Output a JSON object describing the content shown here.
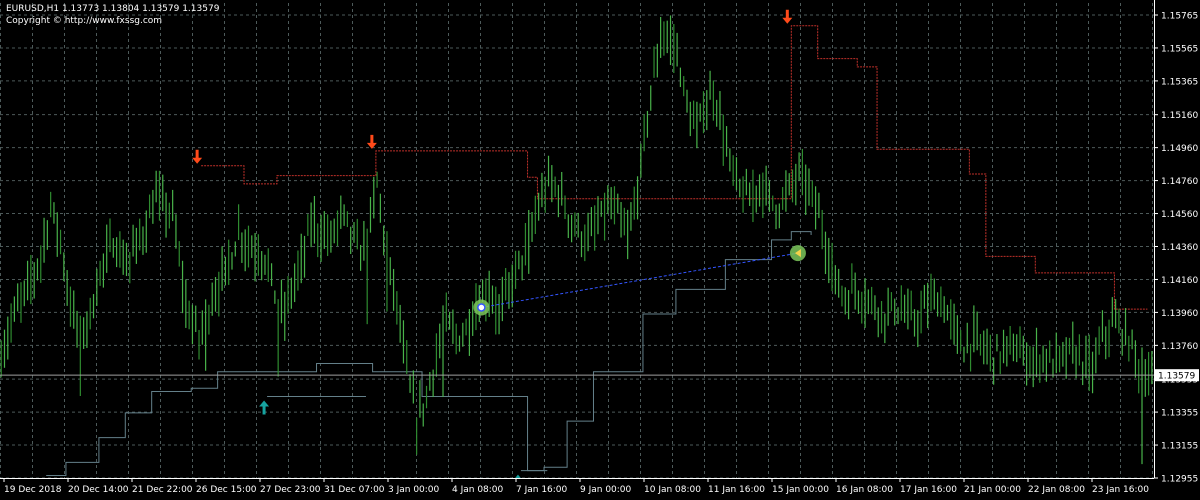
{
  "header": {
    "title": "EURUSD,H1  1.13773 1.13804 1.13579 1.13579",
    "copyright": "Copyright © http://www.fxssg.com"
  },
  "colors": {
    "background": "#000000",
    "grid": "#4d5a5a",
    "candle": "#49b34a",
    "candle_dark": "#2f8c30",
    "stop_line": "#c0302a",
    "trail_line": "#64808a",
    "connector": "#3355ff",
    "arrow_sell": "#ff4a1a",
    "arrow_buy": "#16a3a0",
    "marker": "#7cc85c",
    "axis_text": "#ffffff",
    "current_price_line": "#a0a0a0"
  },
  "chart_data": {
    "type": "line",
    "symbol": "EURUSD",
    "timeframe": "H1",
    "ylim": [
      1.12955,
      1.15765
    ],
    "y_ticks": [
      "1.15765",
      "1.15565",
      "1.15365",
      "1.15160",
      "1.14960",
      "1.14760",
      "1.14560",
      "1.14360",
      "1.14160",
      "1.13960",
      "1.13760",
      "1.13555",
      "1.13355",
      "1.13155",
      "1.12955"
    ],
    "x_ticks": [
      "19 Dec 2018",
      "20 Dec 14:00",
      "21 Dec 22:00",
      "26 Dec 15:00",
      "27 Dec 23:00",
      "31 Dec 07:00",
      "3 Jan 00:00",
      "4 Jan 08:00",
      "7 Jan 16:00",
      "9 Jan 00:00",
      "10 Jan 08:00",
      "11 Jan 16:00",
      "15 Jan 00:00",
      "16 Jan 08:00",
      "17 Jan 16:00",
      "21 Jan 00:00",
      "22 Jan 08:00",
      "23 Jan 16:00"
    ],
    "current_price": "1.13579",
    "price_path": [
      [
        0,
        1.137
      ],
      [
        4,
        1.1395
      ],
      [
        8,
        1.141
      ],
      [
        12,
        1.143
      ],
      [
        15,
        1.146
      ],
      [
        18,
        1.144
      ],
      [
        21,
        1.14
      ],
      [
        24,
        1.138
      ],
      [
        27,
        1.1395
      ],
      [
        30,
        1.142
      ],
      [
        34,
        1.144
      ],
      [
        38,
        1.1425
      ],
      [
        42,
        1.144
      ],
      [
        47,
        1.1465
      ],
      [
        52,
        1.1455
      ],
      [
        56,
        1.14
      ],
      [
        60,
        1.138
      ],
      [
        64,
        1.1405
      ],
      [
        68,
        1.142
      ],
      [
        72,
        1.1445
      ],
      [
        76,
        1.1435
      ],
      [
        80,
        1.143
      ],
      [
        84,
        1.14
      ],
      [
        86,
        1.1395
      ],
      [
        88,
        1.141
      ],
      [
        91,
        1.1425
      ],
      [
        94,
        1.145
      ],
      [
        97,
        1.1445
      ],
      [
        100,
        1.144
      ],
      [
        103,
        1.1455
      ],
      [
        106,
        1.1445
      ],
      [
        109,
        1.143
      ],
      [
        112,
        1.145
      ],
      [
        114,
        1.1475
      ],
      [
        117,
        1.143
      ],
      [
        120,
        1.14
      ],
      [
        123,
        1.136
      ],
      [
        126,
        1.133
      ],
      [
        129,
        1.1345
      ],
      [
        132,
        1.137
      ],
      [
        135,
        1.139
      ],
      [
        138,
        1.138
      ],
      [
        141,
        1.1385
      ],
      [
        144,
        1.14
      ],
      [
        148,
        1.141
      ],
      [
        151,
        1.1395
      ],
      [
        154,
        1.141
      ],
      [
        157,
        1.1425
      ],
      [
        160,
        1.144
      ],
      [
        163,
        1.146
      ],
      [
        166,
        1.1475
      ],
      [
        169,
        1.147
      ],
      [
        172,
        1.1455
      ],
      [
        175,
        1.1445
      ],
      [
        178,
        1.144
      ],
      [
        181,
        1.145
      ],
      [
        184,
        1.146
      ],
      [
        187,
        1.1455
      ],
      [
        190,
        1.144
      ],
      [
        193,
        1.147
      ],
      [
        195,
        1.15
      ],
      [
        197,
        1.153
      ],
      [
        199,
        1.155
      ],
      [
        201,
        1.1565
      ],
      [
        203,
        1.156
      ],
      [
        205,
        1.1555
      ],
      [
        207,
        1.153
      ],
      [
        209,
        1.1515
      ],
      [
        211,
        1.1505
      ],
      [
        213,
        1.152
      ],
      [
        216,
        1.153
      ],
      [
        218,
        1.1515
      ],
      [
        221,
        1.1485
      ],
      [
        224,
        1.147
      ],
      [
        227,
        1.1465
      ],
      [
        230,
        1.1475
      ],
      [
        233,
        1.1465
      ],
      [
        236,
        1.146
      ],
      [
        239,
        1.147
      ],
      [
        242,
        1.148
      ],
      [
        245,
        1.147
      ],
      [
        248,
        1.1455
      ],
      [
        250,
        1.144
      ],
      [
        253,
        1.1415
      ],
      [
        256,
        1.1405
      ],
      [
        259,
        1.141
      ],
      [
        262,
        1.1405
      ],
      [
        265,
        1.14
      ],
      [
        268,
        1.1395
      ],
      [
        271,
        1.14
      ],
      [
        274,
        1.1395
      ],
      [
        277,
        1.139
      ],
      [
        280,
        1.1398
      ],
      [
        283,
        1.1405
      ],
      [
        286,
        1.14
      ],
      [
        289,
        1.1385
      ],
      [
        292,
        1.1375
      ],
      [
        295,
        1.138
      ],
      [
        298,
        1.1375
      ],
      [
        301,
        1.137
      ],
      [
        304,
        1.1372
      ],
      [
        307,
        1.1375
      ],
      [
        310,
        1.137
      ],
      [
        313,
        1.1366
      ],
      [
        316,
        1.137
      ],
      [
        319,
        1.1365
      ],
      [
        322,
        1.1368
      ],
      [
        325,
        1.1372
      ],
      [
        328,
        1.1366
      ],
      [
        331,
        1.1362
      ],
      [
        334,
        1.138
      ],
      [
        337,
        1.139
      ],
      [
        340,
        1.1385
      ],
      [
        343,
        1.1375
      ],
      [
        346,
        1.136
      ],
      [
        349,
        1.1358
      ]
    ],
    "stop_line_red": [
      [
        61,
        1.1485
      ],
      [
        71,
        1.1485
      ],
      [
        74,
        1.1474
      ],
      [
        83,
        1.1474
      ],
      [
        84,
        1.1479
      ],
      [
        114,
        1.1494
      ],
      [
        158,
        1.1494
      ],
      [
        160,
        1.1478
      ],
      [
        163,
        1.1465
      ],
      [
        240,
        1.157
      ],
      [
        248,
        1.155
      ],
      [
        260,
        1.1545
      ],
      [
        266,
        1.1495
      ],
      [
        286,
        1.1495
      ],
      [
        294,
        1.148
      ],
      [
        299,
        1.143
      ],
      [
        314,
        1.142
      ],
      [
        330,
        1.142
      ],
      [
        338,
        1.1398
      ],
      [
        348,
        1.1398
      ]
    ],
    "trail_line_gray": [
      [
        14,
        1.1297
      ],
      [
        20,
        1.1305
      ],
      [
        30,
        1.132
      ],
      [
        38,
        1.1335
      ],
      [
        46,
        1.1348
      ],
      [
        58,
        1.135
      ],
      [
        66,
        1.136
      ],
      [
        80,
        1.136
      ],
      [
        96,
        1.1365
      ],
      [
        113,
        1.136
      ],
      [
        128,
        1.1345
      ],
      [
        160,
        1.13
      ],
      [
        165,
        1.1302
      ],
      [
        172,
        1.133
      ],
      [
        180,
        1.136
      ],
      [
        195,
        1.1395
      ],
      [
        205,
        1.141
      ],
      [
        220,
        1.1428
      ],
      [
        234,
        1.144
      ],
      [
        240,
        1.1445
      ],
      [
        246,
        1.1443
      ]
    ],
    "teal_line_segments": [
      {
        "x": [
          81,
          111
        ],
        "y": 1.1345
      },
      {
        "x": [
          158,
          166
        ],
        "y": 1.13
      }
    ],
    "connector_line": {
      "from": [
        146,
        1.1399
      ],
      "to": [
        242,
        1.1432
      ]
    },
    "sell_arrows": [
      [
        61,
        1.1485
      ],
      [
        114,
        1.1494
      ],
      [
        240,
        1.157
      ]
    ],
    "buy_arrows": [
      [
        81,
        1.1345
      ],
      [
        158,
        1.13
      ]
    ],
    "markers": [
      {
        "x": 146,
        "y": 1.1399,
        "kind": "entry"
      },
      {
        "x": 242,
        "y": 1.1432,
        "kind": "exit"
      }
    ]
  }
}
